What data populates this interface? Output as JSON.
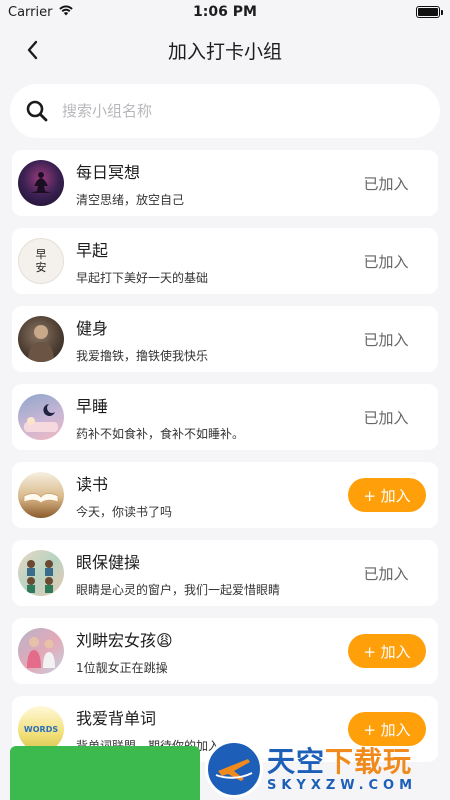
{
  "status_bar": {
    "carrier": "Carrier",
    "time": "1:06 PM"
  },
  "nav": {
    "title": "加入打卡小组"
  },
  "search": {
    "placeholder": "搜索小组名称",
    "value": ""
  },
  "groups": [
    {
      "name": "每日冥想",
      "desc": "清空思绪，放空自己",
      "status": "已加入",
      "joined": true
    },
    {
      "name": "早起",
      "desc": "早起打下美好一天的基础",
      "status": "已加入",
      "joined": true
    },
    {
      "name": "健身",
      "desc": "我爱撸铁，撸铁使我快乐",
      "status": "已加入",
      "joined": true
    },
    {
      "name": "早睡",
      "desc": "药补不如食补，食补不如睡补。",
      "status": "已加入",
      "joined": true
    },
    {
      "name": "读书",
      "desc": "今天，你读书了吗",
      "status": "+ 加入",
      "joined": false
    },
    {
      "name": "眼保健操",
      "desc": "眼睛是心灵的窗户，我们一起爱惜眼睛",
      "status": "已加入",
      "joined": true
    },
    {
      "name": "刘畊宏女孩😩",
      "desc": "1位靓女正在跳操",
      "status": "+ 加入",
      "joined": false
    },
    {
      "name": "我爱背单词",
      "desc": "背单词联盟，期待你的加入",
      "status": "+ 加入",
      "joined": false
    }
  ],
  "avatars": {
    "morning_text": "早\n安",
    "words_text": "WORDS"
  },
  "watermark": {
    "title_a": "天空",
    "title_b": "下载玩",
    "sub": "SKYXZW.COM"
  },
  "colors": {
    "accent": "#ff9f0a",
    "background": "#f5f5f7",
    "green": "#3dba4e",
    "brand_blue": "#1d5fb8"
  }
}
